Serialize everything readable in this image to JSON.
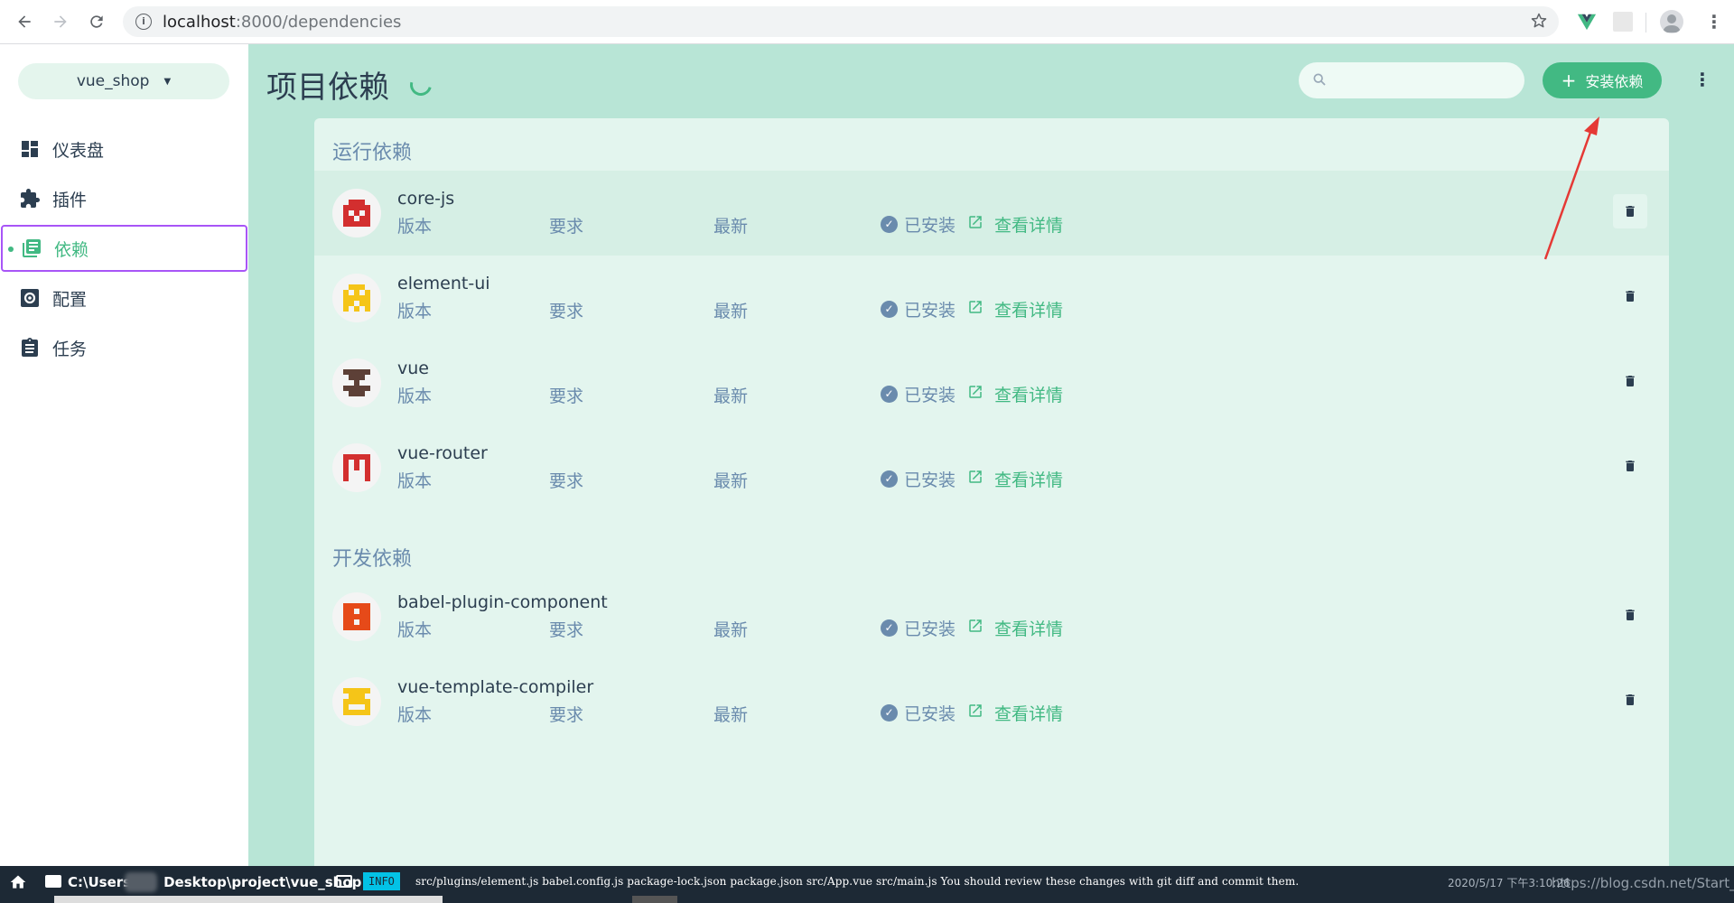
{
  "browser": {
    "url_host": "localhost",
    "url_rest": ":8000/dependencies",
    "info_glyph": "i"
  },
  "sidebar": {
    "project": "vue_shop",
    "items": [
      {
        "label": "仪表盘",
        "icon": "dashboard-icon"
      },
      {
        "label": "插件",
        "icon": "puzzle-icon"
      },
      {
        "label": "依赖",
        "icon": "library-books-icon",
        "active": true
      },
      {
        "label": "配置",
        "icon": "settings-icon"
      },
      {
        "label": "任务",
        "icon": "clipboard-icon"
      }
    ]
  },
  "header": {
    "title": "项目依赖",
    "search_placeholder": "",
    "install_label": "安装依赖",
    "install_plus": "+"
  },
  "sections": {
    "runtime_title": "运行依赖",
    "dev_title": "开发依赖"
  },
  "labels": {
    "version": "版本",
    "required": "要求",
    "latest": "最新",
    "installed": "已安装",
    "details": "查看详情"
  },
  "dependencies": {
    "runtime": [
      {
        "name": "core-js",
        "logo_color": "#d32f2f"
      },
      {
        "name": "element-ui",
        "logo_color": "#f5c518"
      },
      {
        "name": "vue",
        "logo_color": "#5d4037"
      },
      {
        "name": "vue-router",
        "logo_color": "#d32f2f"
      }
    ],
    "dev": [
      {
        "name": "babel-plugin-component",
        "logo_color": "#e64a19"
      },
      {
        "name": "vue-template-compiler",
        "logo_color": "#f5c518"
      }
    ]
  },
  "statusbar": {
    "path_a": "C:\\Users",
    "path_b": "Desktop\\project\\vue_shop",
    "tag": "INFO",
    "message": "src/plugins/element.js babel.config.js package-lock.json package.json src/App.vue src/main.js You should review these changes with git diff and commit them.",
    "time": "2020/5/17 下午3:10:26",
    "watermark": "https://blog.csdn.net/Start_"
  },
  "colors": {
    "accent": "#42b983",
    "main_bg": "#b8e5d6",
    "panel_bg": "#e3f5ee",
    "text": "#2c3e50",
    "muted": "#6a8bad",
    "active_border": "#a855f7",
    "arrow": "#e53935"
  }
}
